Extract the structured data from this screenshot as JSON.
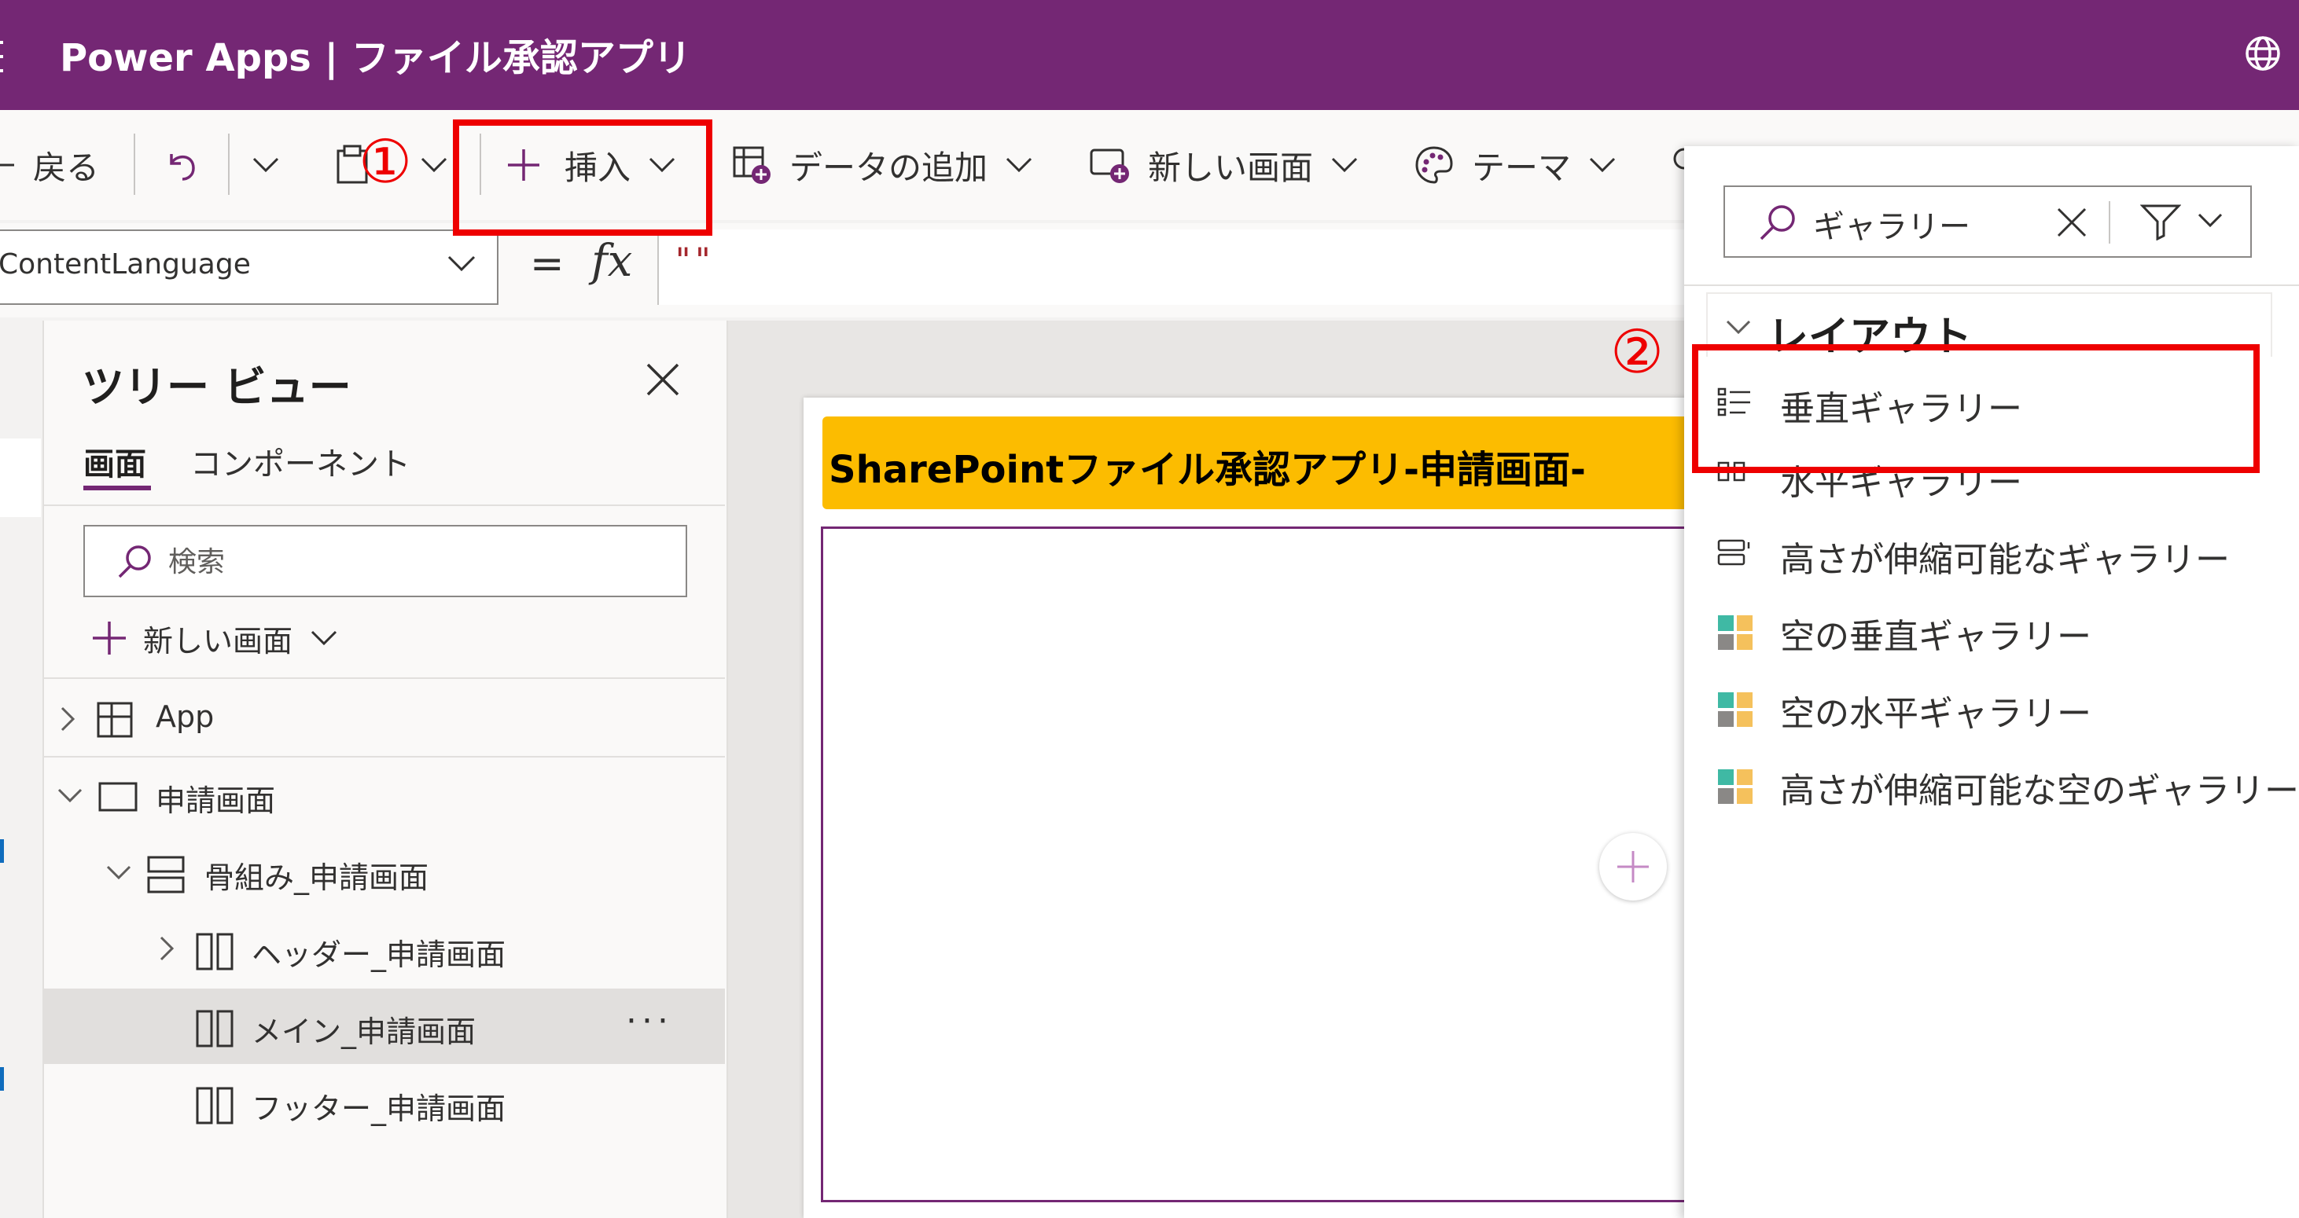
{
  "title_bar": {
    "title": "Power Apps | ファイル承認アプリ"
  },
  "toolbar": {
    "back_label": "戻る",
    "insert_label": "挿入",
    "add_data_label": "データの追加",
    "new_screen_label": "新しい画面",
    "theme_label": "テーマ"
  },
  "formula_bar": {
    "property": "ContentLanguage",
    "equals": "=",
    "fx": "fx",
    "value": "\"\""
  },
  "tree_view": {
    "title": "ツリー ビュー",
    "tabs": [
      "画面",
      "コンポーネント"
    ],
    "search_placeholder": "検索",
    "new_screen_label": "新しい画面",
    "items": [
      {
        "label": "App",
        "icon": "app-icon"
      },
      {
        "label": "申請画面",
        "icon": "screen-icon"
      },
      {
        "label": "骨組み_申請画面",
        "icon": "vertical-container-icon"
      },
      {
        "label": "ヘッダー_申請画面",
        "icon": "horizontal-container-icon"
      },
      {
        "label": "メイン_申請画面",
        "icon": "horizontal-container-icon",
        "selected": true
      },
      {
        "label": "フッター_申請画面",
        "icon": "horizontal-container-icon"
      }
    ],
    "more_label": "···"
  },
  "canvas": {
    "header_text": "SharePointファイル承認アプリ-申請画面-"
  },
  "insert_pane": {
    "search_value": "ギャラリー",
    "section_label": "レイアウト",
    "items": [
      {
        "label": "垂直ギャラリー",
        "icon": "vertical-gallery-icon"
      },
      {
        "label": "水平ギャラリー",
        "icon": "horizontal-gallery-icon"
      },
      {
        "label": "高さが伸縮可能なギャラリー",
        "icon": "flexible-gallery-icon"
      },
      {
        "label": "空の垂直ギャラリー",
        "icon": "blank-gallery-icon"
      },
      {
        "label": "空の水平ギャラリー",
        "icon": "blank-gallery-icon"
      },
      {
        "label": "高さが伸縮可能な空のギャラリー",
        "icon": "blank-gallery-icon"
      }
    ]
  },
  "annotations": {
    "step1": "①",
    "step2": "②"
  },
  "colors": {
    "brand": "#742774",
    "annotation": "#ee0000",
    "header": "#fcbc00"
  }
}
